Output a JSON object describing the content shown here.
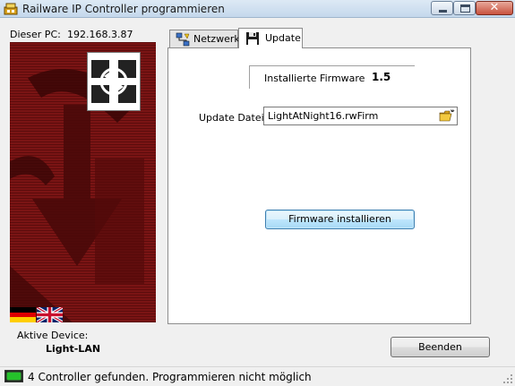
{
  "window": {
    "title": "Railware IP Controller programmieren"
  },
  "left": {
    "pc_label": "Dieser PC:",
    "pc_ip": "192.168.3.87",
    "device_label": "Aktive Device:",
    "device_name": "Light-LAN"
  },
  "tabs": [
    {
      "label": "Netzwerk",
      "icon": "network-icon",
      "selected": false
    },
    {
      "label": "Update",
      "icon": "floppy-disk-icon",
      "selected": true
    }
  ],
  "update": {
    "firmware_label": "Installierte Firmware",
    "firmware_value": "1.5",
    "file_label": "Update Datei",
    "file_value": "LightAtNight16.rwFirm",
    "install_button": "Firmware installieren"
  },
  "buttons": {
    "exit": "Beenden"
  },
  "status": {
    "text": "4 Controller gefunden. Programmieren nicht möglich",
    "led_color": "#25c22b"
  },
  "colors": {
    "panel_red": "#7a1414",
    "panel_dark": "#3a0606"
  }
}
